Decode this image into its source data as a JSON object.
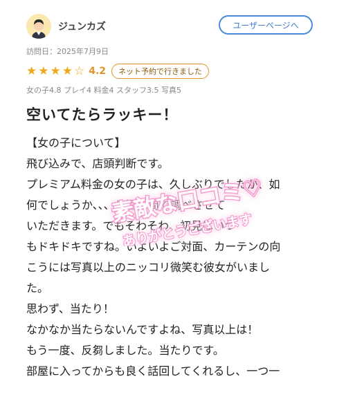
{
  "user": {
    "name": "ジュンカズ",
    "page_button": "ユーザーページへ"
  },
  "review": {
    "visit_date": "訪問日：2025年7月9日",
    "rating": 4.2,
    "rating_text": "4.2",
    "stars": [
      "full",
      "full",
      "full",
      "full",
      "empty"
    ],
    "reservation_badge": "ネット予約で行きました",
    "sub_ratings": "女の子4.8 プレイ4 料金4 スタッフ3.5 写真5",
    "title": "空いてたらラッキー！",
    "body": "【女の子について】\n飛び込みで、店頭判断です。\nプレミアム料金の女の子は、久しぶりでしたが、如\n何でしょうか、、、と短時間で調べさせて\nいただきます。でもそわそわ、初見はいつ\nもドキドキですね。いよいよご対面、カーテンの向\nこうには写真以上のニッコリ微笑む彼女がいまし\nた。\n思わず、当たり！\nなかなか当たらないんですよね、写真以上は！\nもう一度、反芻しました。当たりです。\n部屋に入ってからも良く話回してくれるし、一つ一"
  },
  "overlay_stamp": {
    "line1": "素敵な口コミ♡",
    "line2": "ありがとうございます"
  },
  "colors": {
    "accent_blue": "#4a8ad8",
    "star": "#f0a81c",
    "badge_border": "#e0952a",
    "stamp_pink": "#f7a8d6"
  }
}
